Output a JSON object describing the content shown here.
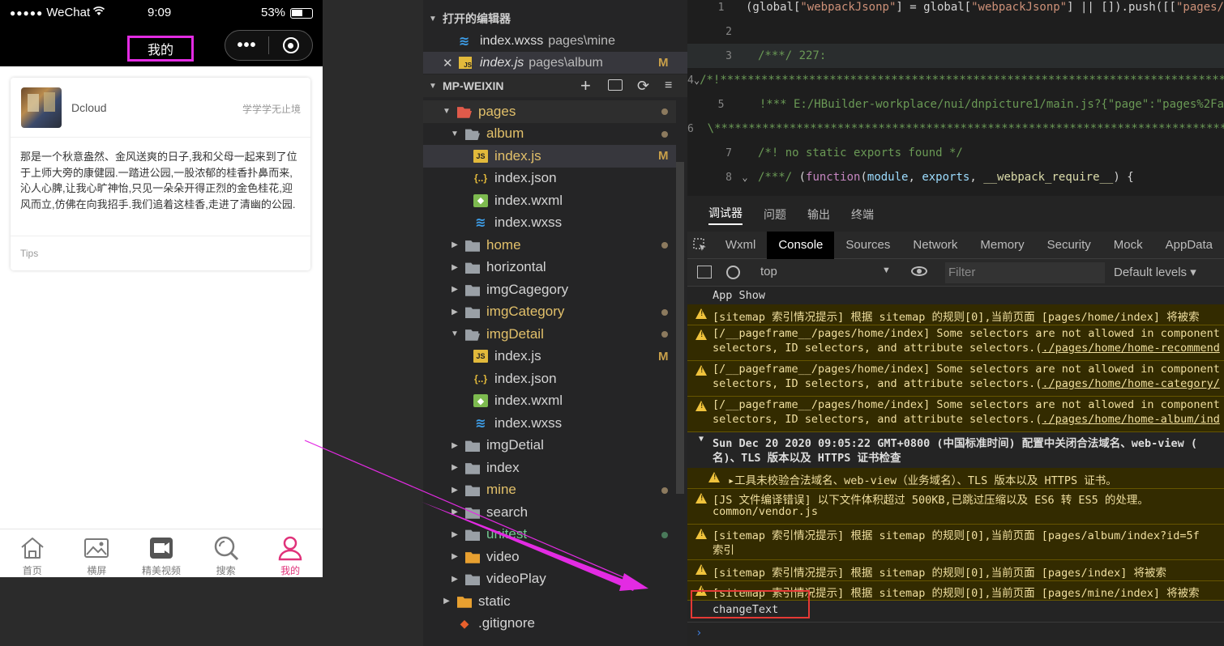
{
  "phone": {
    "status": {
      "carrier": "WeChat",
      "time": "9:09",
      "battery": "53%"
    },
    "nav_title": "我的",
    "card": {
      "name": "Dcloud",
      "extra": "学学学无止境",
      "body": "那是一个秋意盎然、金风送爽的日子,我和父母一起来到了位于上师大旁的康健园.一踏进公园,一股浓郁的桂香扑鼻而来,沁人心脾,让我心旷神怡,只见一朵朵开得正烈的金色桂花,迎风而立,仿佛在向我招手.我们追着这桂香,走进了清幽的公园.",
      "footer": "Tips"
    },
    "tabbar": [
      {
        "label": "首页",
        "icon": "home-icon"
      },
      {
        "label": "横屏",
        "icon": "image-icon"
      },
      {
        "label": "精美视频",
        "icon": "video-icon"
      },
      {
        "label": "搜索",
        "icon": "search-icon"
      },
      {
        "label": "我的",
        "icon": "user-icon"
      }
    ],
    "active_color": "#e0327a"
  },
  "explorer": {
    "open_editors_title": "打开的编辑器",
    "open_editors": [
      {
        "name": "index.wxss",
        "path": "pages\\mine",
        "mark": ""
      },
      {
        "name": "index.js",
        "path": "pages\\album",
        "mark": "M"
      }
    ],
    "project_title": "MP-WEIXIN",
    "tree": [
      {
        "label": "pages",
        "type": "folder-open",
        "status": "dot"
      },
      {
        "label": "album",
        "type": "folder-open",
        "status": "dot"
      },
      {
        "label": "index.js",
        "type": "js",
        "status": "M"
      },
      {
        "label": "index.json",
        "type": "json",
        "status": ""
      },
      {
        "label": "index.wxml",
        "type": "wxml",
        "status": ""
      },
      {
        "label": "index.wxss",
        "type": "wxss",
        "status": ""
      },
      {
        "label": "home",
        "type": "folder",
        "status": "dot"
      },
      {
        "label": "horizontal",
        "type": "folder",
        "status": ""
      },
      {
        "label": "imgCagegory",
        "type": "folder",
        "status": ""
      },
      {
        "label": "imgCategory",
        "type": "folder",
        "status": "dot"
      },
      {
        "label": "imgDetail",
        "type": "folder-open",
        "status": "dot"
      },
      {
        "label": "index.js",
        "type": "js",
        "status": "M"
      },
      {
        "label": "index.json",
        "type": "json",
        "status": ""
      },
      {
        "label": "index.wxml",
        "type": "wxml",
        "status": ""
      },
      {
        "label": "index.wxss",
        "type": "wxss",
        "status": ""
      },
      {
        "label": "imgDetial",
        "type": "folder",
        "status": ""
      },
      {
        "label": "index",
        "type": "folder",
        "status": ""
      },
      {
        "label": "mine",
        "type": "folder",
        "status": "dot"
      },
      {
        "label": "search",
        "type": "folder",
        "status": ""
      },
      {
        "label": "unitest",
        "type": "folder",
        "status": "dot-green"
      },
      {
        "label": "video",
        "type": "folder",
        "status": ""
      },
      {
        "label": "videoPlay",
        "type": "folder",
        "status": ""
      },
      {
        "label": "static",
        "type": "folder",
        "status": ""
      },
      {
        "label": ".gitignore",
        "type": "git",
        "status": ""
      }
    ]
  },
  "editor": {
    "lines": [
      {
        "num": "1",
        "html": "(global[<span class='c-str'>\"webpackJsonp\"</span>] = global[<span class='c-str'>\"webpackJsonp\"</span>] || []).push([[<span class='c-str'>\"pages/</span>"
      },
      {
        "num": "2",
        "html": ""
      },
      {
        "num": "3",
        "html": "<span class='c-com'>/***/ 227:</span>"
      },
      {
        "num": "4",
        "html": "<span class='c-com'>/*!*******************************************************************************</span>"
      },
      {
        "num": "5",
        "html": "<span class='c-com'>  !*** E:/HBuilder-workplace/nui/dnpicture1/main.js?{\"page\":\"pages%2Fa</span>"
      },
      {
        "num": "6",
        "html": "<span class='c-com'>  \\*****************************************************************************</span>"
      },
      {
        "num": "7",
        "html": "<span class='c-com'>/*! no static exports found */</span>"
      },
      {
        "num": "8",
        "html": "<span class='c-com'>/***/</span> (<span class='c-kw'>function</span>(<span class='c-var'>module</span>, <span class='c-var'>exports</span>, <span class='c-def'>__webpack_require__</span>) {"
      }
    ]
  },
  "devtools": {
    "top_tabs": [
      "调试器",
      "问题",
      "输出",
      "终端"
    ],
    "panel_tabs": [
      "Wxml",
      "Console",
      "Sources",
      "Network",
      "Memory",
      "Security",
      "Mock",
      "AppData"
    ],
    "active_panel": "Console",
    "context": "top",
    "filter_placeholder": "Filter",
    "levels": "Default levels",
    "messages": {
      "app_show": "App Show",
      "w1": "[sitemap 索引情况提示] 根据 sitemap 的规则[0],当前页面 [pages/home/index] 将被索",
      "w2a": "[/__pageframe__/pages/home/index] Some selectors are not allowed in component",
      "w2b_pre": "selectors, ID selectors, and attribute selectors.(",
      "w2b_link": "./pages/home/home-recommend",
      "w3b_link": "./pages/home/home-category/",
      "w4b_link": "./pages/home/home-album/ind",
      "group1": "Sun Dec 20 2020 09:05:22 GMT+0800 (中国标准时间) 配置中关闭合法域名、web-view (",
      "group2": "名)、TLS 版本以及 HTTPS 证书检查",
      "w5": "▸工具未校验合法域名、web-view（业务域名）、TLS 版本以及 HTTPS 证书。",
      "w6a": "[JS 文件编译错误] 以下文件体积超过 500KB,已跳过压缩以及 ES6 转 ES5 的处理。",
      "w6b": "common/vendor.js",
      "w7a": "[sitemap 索引情况提示] 根据 sitemap 的规则[0],当前页面 [pages/album/index?id=5f",
      "w7b": "索引",
      "w8": "[sitemap 索引情况提示] 根据 sitemap 的规则[0],当前页面 [pages/index] 将被索",
      "w9": "[sitemap 索引情况提示] 根据 sitemap 的规则[0],当前页面 [pages/mine/index] 将被索",
      "log": "changeText"
    },
    "prompt": "›"
  },
  "colors": {
    "annotation": "#e32be3",
    "highlight_box": "#e53935"
  }
}
